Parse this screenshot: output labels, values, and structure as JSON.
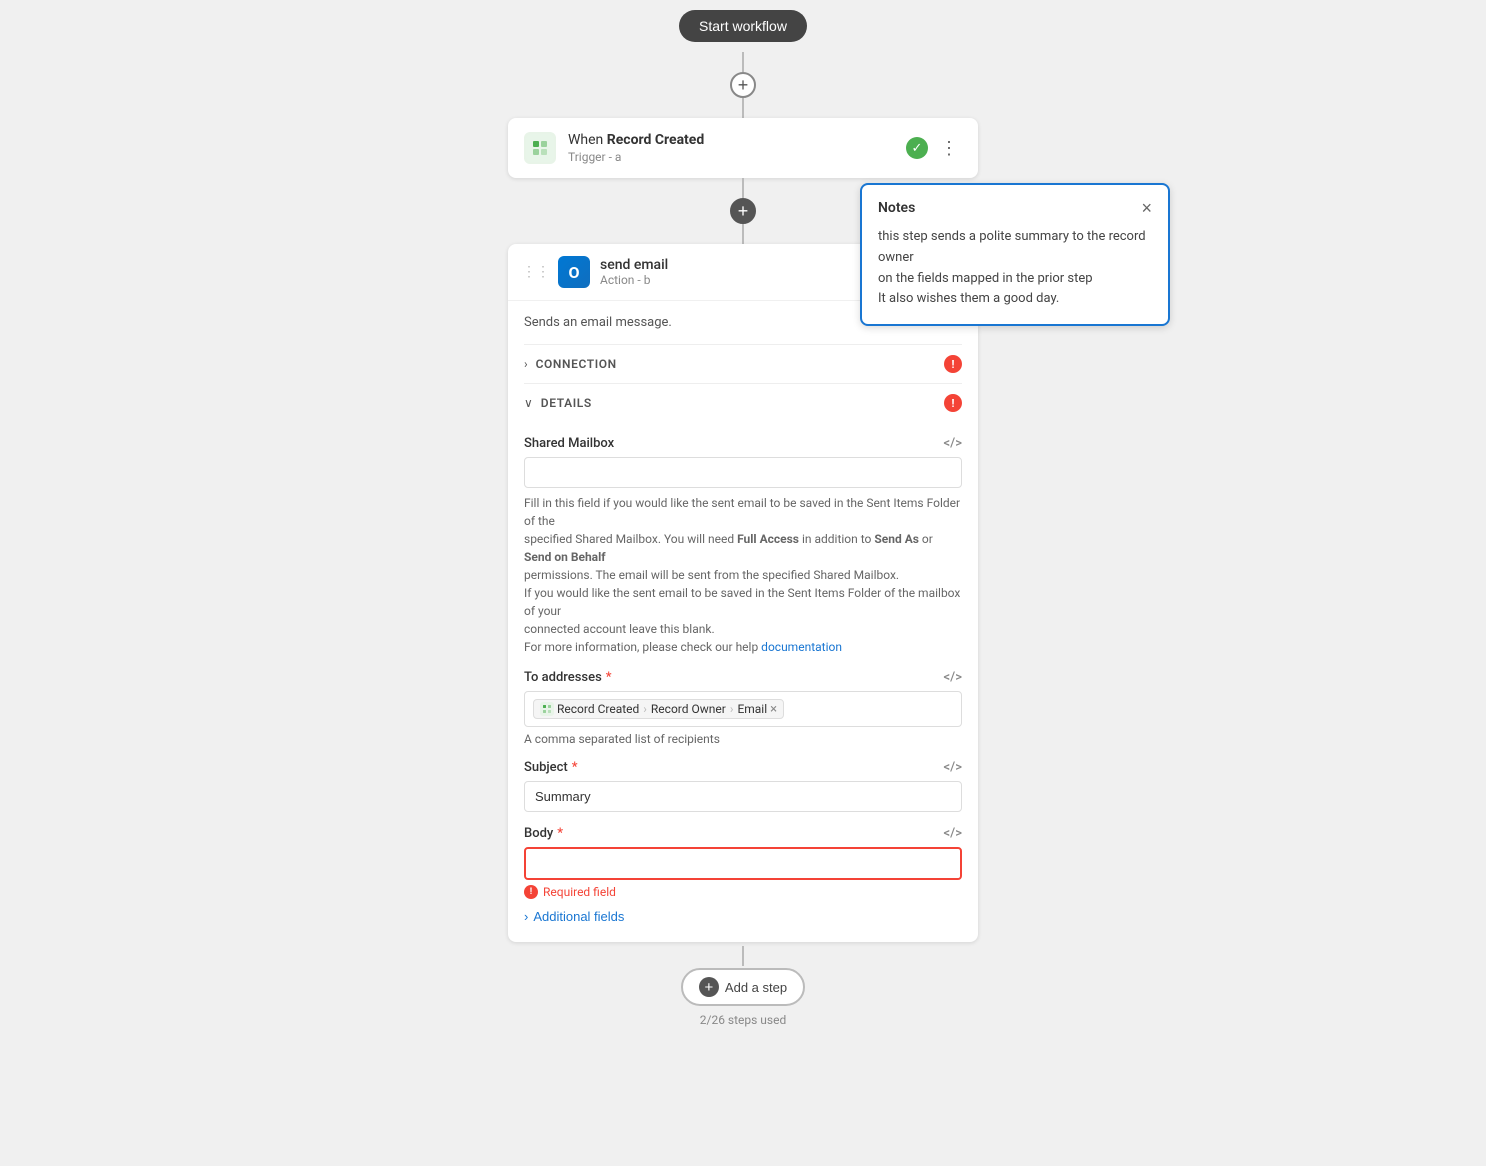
{
  "header": {
    "start_workflow_label": "Start workflow"
  },
  "trigger": {
    "pre_title": "When ",
    "title_bold": "Record Created",
    "subtitle": "Trigger - a",
    "status": "active"
  },
  "action": {
    "title": "send email",
    "subtitle": "Action - b",
    "description": "Sends an email message.",
    "connection_label": "CONNECTION",
    "details_label": "DETAILS",
    "shared_mailbox": {
      "label": "Shared Mailbox",
      "value": "",
      "placeholder": ""
    },
    "shared_mailbox_hint": "Fill in this field if you would like the sent email to be saved in the Sent Items Folder of the specified Shared Mailbox. You will need Full Access in addition to Send As or Send on Behalf permissions. The email will be sent from the specified Shared Mailbox. If you would like the sent email to be saved in the Sent Items Folder of the mailbox of your connected account leave this blank. For more information, please check our help",
    "documentation_link": "documentation",
    "to_addresses": {
      "label": "To addresses",
      "required": true,
      "tags": [
        {
          "icon": "record-icon",
          "parts": [
            "Record Created",
            "Record Owner",
            "Email"
          ]
        },
        {
          "label": "×"
        }
      ],
      "hint": "A comma separated list of recipients"
    },
    "subject": {
      "label": "Subject",
      "required": true,
      "value": "Summary"
    },
    "body": {
      "label": "Body",
      "required": true,
      "value": "",
      "error": "Required field"
    },
    "additional_fields_label": "Additional fields"
  },
  "notes": {
    "title": "Notes",
    "body_line1": "this step sends a polite summary to the record owner",
    "body_line2": "on the fields mapped in the prior step",
    "body_line3": "It also wishes them a good day."
  },
  "footer": {
    "add_step_label": "Add a step",
    "steps_used": "2/26 steps used"
  },
  "icons": {
    "plus": "+",
    "check": "✓",
    "warning": "!",
    "more": "⋮",
    "close": "×",
    "chevron_right": "›",
    "chevron_down": "∨",
    "code": "</>",
    "drag": "⋮⋮",
    "notes_icon": "📋",
    "arrow_right": "›"
  }
}
